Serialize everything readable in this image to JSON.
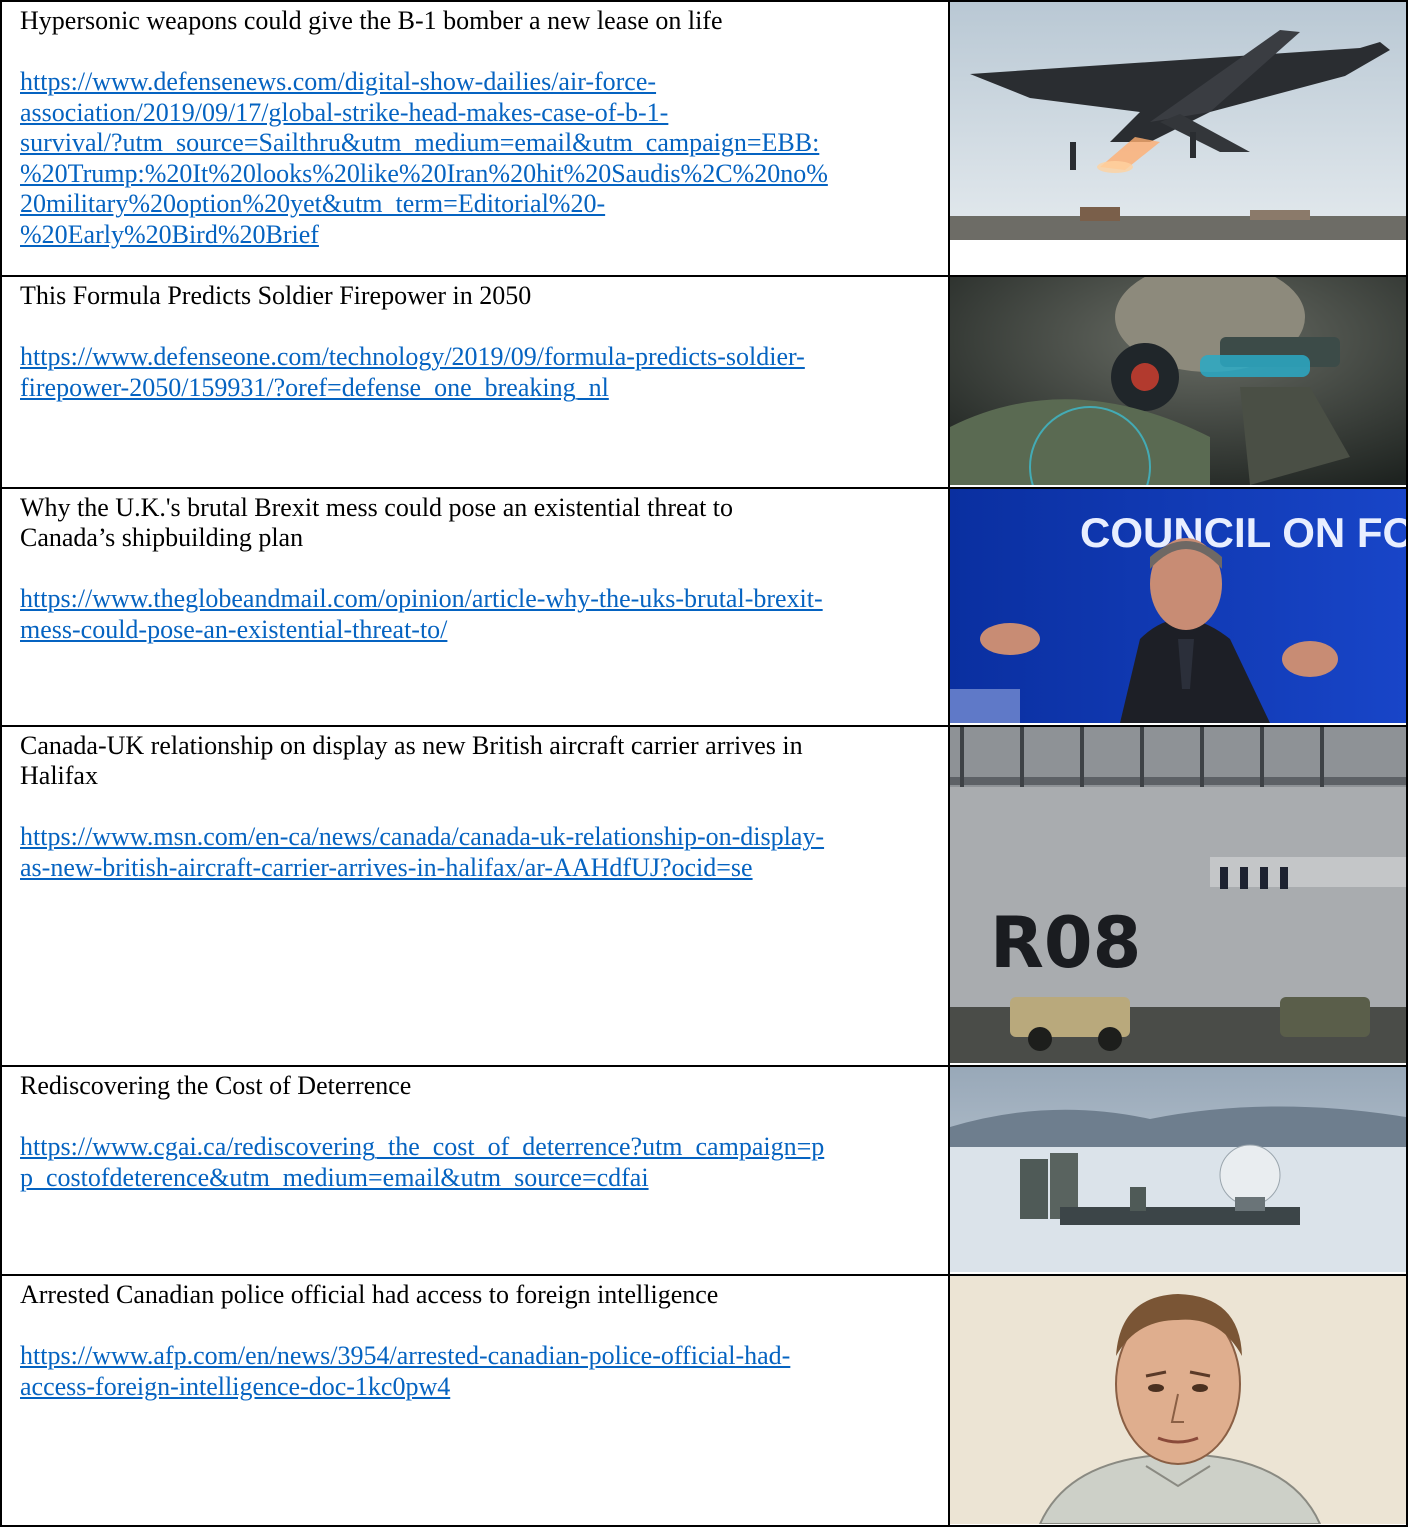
{
  "articles": [
    {
      "title": "Hypersonic weapons could give the B-1 bomber a new lease on life",
      "url_lines": [
        "https://www.defensenews.com/digital-show-dailies/air-force-",
        "association/2019/09/17/global-strike-head-makes-case-of-b-1-",
        "survival/?utm_source=Sailthru&utm_medium=email&utm_campaign=EBB:",
        "%20Trump:%20It%20looks%20like%20Iran%20hit%20Saudis%2C%20no%",
        "20military%20option%20yet&utm_term=Editorial%20-",
        "%20Early%20Bird%20Brief"
      ],
      "image": "b1-bomber-takeoff-photo"
    },
    {
      "title": "This Formula Predicts Soldier Firepower in 2050",
      "url_lines": [
        "https://www.defenseone.com/technology/2019/09/formula-predicts-soldier-",
        "firepower-2050/159931/?oref=defense_one_breaking_nl"
      ],
      "image": "future-soldier-photo"
    },
    {
      "title_lines": [
        "Why the U.K.'s brutal Brexit mess could pose an existential threat to",
        "Canada’s shipbuilding plan"
      ],
      "url_lines": [
        "https://www.theglobeandmail.com/opinion/article-why-the-uks-brutal-brexit-",
        "mess-could-pose-an-existential-threat-to/"
      ],
      "image": "speaker-council-foreign-relations-photo",
      "image_text": "COUNCIL ON FOREIGN RELATIONS"
    },
    {
      "title_lines": [
        "Canada-UK relationship on display as new British aircraft carrier arrives in",
        "Halifax"
      ],
      "url_lines": [
        "https://www.msn.com/en-ca/news/canada/canada-uk-relationship-on-display-",
        "as-new-british-aircraft-carrier-arrives-in-halifax/ar-AAHdfUJ?ocid=se"
      ],
      "image": "aircraft-carrier-r08-photo",
      "image_text": "R08"
    },
    {
      "title": "Rediscovering the Cost of Deterrence",
      "url_lines": [
        "https://www.cgai.ca/rediscovering_the_cost_of_deterrence?utm_campaign=p",
        "p_costofdeterence&utm_medium=email&utm_source=cdfai"
      ],
      "image": "arctic-radar-station-photo"
    },
    {
      "title": "Arrested Canadian police official had access to foreign intelligence",
      "url_lines": [
        "https://www.afp.com/en/news/3954/arrested-canadian-police-official-had-",
        "access-foreign-intelligence-doc-1kc0pw4"
      ],
      "image": "courtroom-sketch-portrait"
    }
  ],
  "colors": {
    "link": "#0563c1",
    "border": "#000000"
  }
}
